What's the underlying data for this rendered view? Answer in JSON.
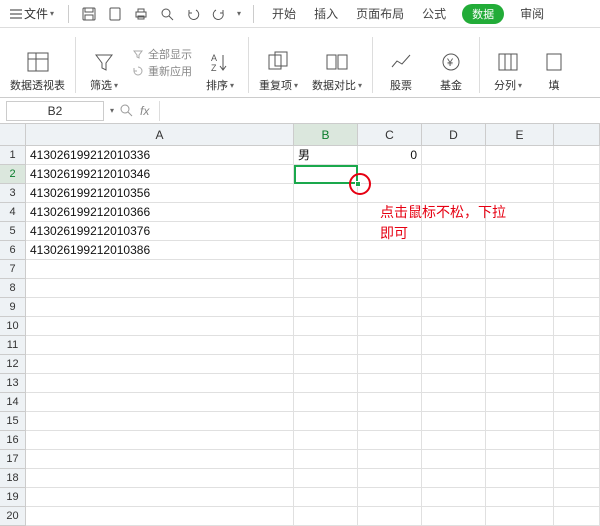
{
  "menubar": {
    "file_label": "文件",
    "tabs": [
      "开始",
      "插入",
      "页面布局",
      "公式",
      "数据",
      "审阅"
    ],
    "active_tab_index": 4
  },
  "ribbon": {
    "pivot": "数据透视表",
    "filter": "筛选",
    "show_all": "全部显示",
    "reapply": "重新应用",
    "sort": "排序",
    "duplicates": "重复项",
    "compare": "数据对比",
    "stocks": "股票",
    "funds": "基金",
    "split": "分列",
    "fill": "填"
  },
  "fxbar": {
    "active_cell": "B2"
  },
  "grid": {
    "columns": [
      "A",
      "B",
      "C",
      "D",
      "E"
    ],
    "selected_col": "B",
    "selected_row": 2,
    "row_count": 20,
    "cells": {
      "A1": "413026199212010336",
      "A2": "413026199212010346",
      "A3": "413026199212010356",
      "A4": "413026199212010366",
      "A5": "413026199212010376",
      "A6": "413026199212010386",
      "B1": "男",
      "C1": "0"
    }
  },
  "annotation": {
    "line1": "点击鼠标不松，下拉",
    "line2": "即可"
  },
  "icons": {
    "menu": "menu-icon",
    "save": "save-icon",
    "print": "print-icon",
    "preview": "preview-icon",
    "undo": "undo-icon",
    "redo": "redo-icon"
  }
}
